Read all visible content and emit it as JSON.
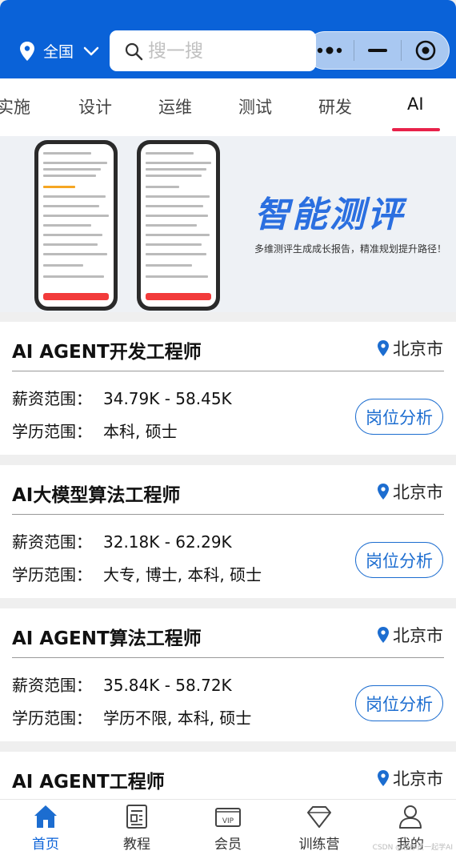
{
  "header": {
    "location": "全国",
    "search_placeholder": "搜一搜",
    "accent": "#0a62d8"
  },
  "tabs": [
    {
      "label": "实施"
    },
    {
      "label": "设计"
    },
    {
      "label": "运维"
    },
    {
      "label": "测试"
    },
    {
      "label": "研发"
    },
    {
      "label": "AI",
      "active": true
    }
  ],
  "banner": {
    "title": "智能测评",
    "subtitle": "多维测评生成成长报告，精准规划提升路径！"
  },
  "jobs": [
    {
      "title": "AI AGENT开发工程师",
      "city": "北京市",
      "salary_label": "薪资范围：",
      "salary": "34.79K - 58.45K",
      "edu_label": "学历范围：",
      "education": "本科, 硕士",
      "action": "岗位分析"
    },
    {
      "title": "AI大模型算法工程师",
      "city": "北京市",
      "salary_label": "薪资范围：",
      "salary": "32.18K - 62.29K",
      "edu_label": "学历范围：",
      "education": "大专, 博士, 本科, 硕士",
      "action": "岗位分析"
    },
    {
      "title": "AI AGENT算法工程师",
      "city": "北京市",
      "salary_label": "薪资范围：",
      "salary": "35.84K - 58.72K",
      "edu_label": "学历范围：",
      "education": "学历不限, 本科, 硕士",
      "action": "岗位分析"
    },
    {
      "title": "AI AGENT工程师",
      "city": "北京市"
    }
  ],
  "bottom_nav": [
    {
      "label": "首页",
      "icon": "home-icon",
      "active": true
    },
    {
      "label": "教程",
      "icon": "tutorial-icon"
    },
    {
      "label": "会员",
      "icon": "vip-icon"
    },
    {
      "label": "训练营",
      "icon": "diamond-icon"
    },
    {
      "label": "我的",
      "icon": "user-icon"
    }
  ],
  "watermark": "CSDN @程序员一起学AI"
}
